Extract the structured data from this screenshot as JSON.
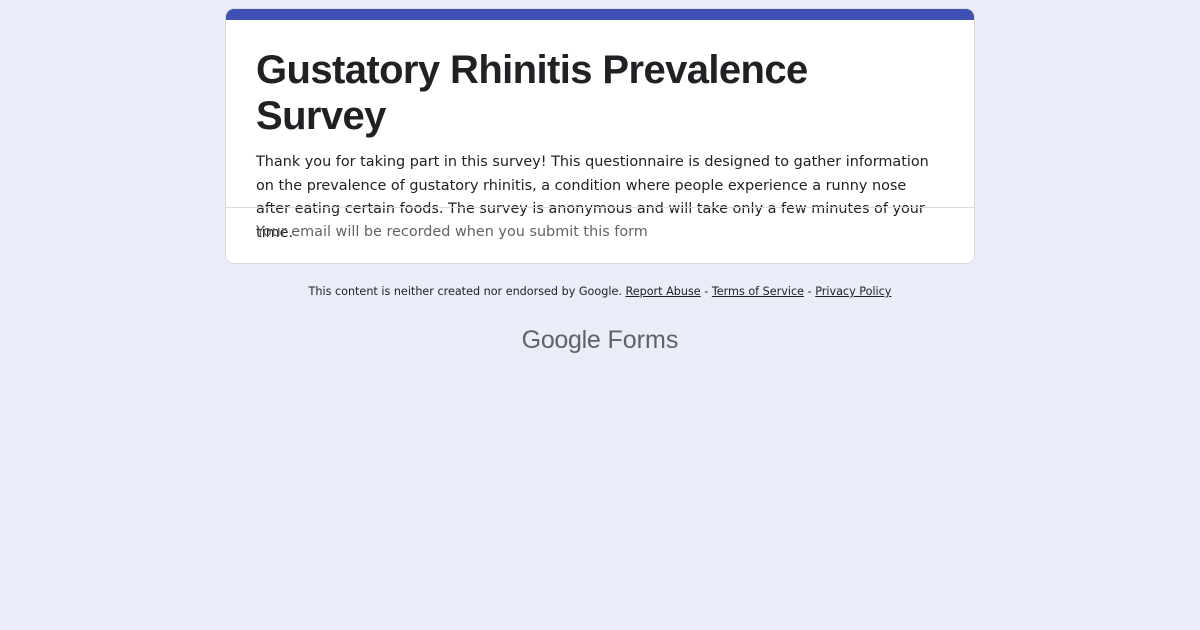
{
  "form": {
    "title": "Gustatory Rhinitis Prevalence Survey",
    "description": "Thank you for taking part in this survey! This questionnaire is designed to gather information on the prevalence of gustatory rhinitis, a condition where people experience a runny nose after eating certain foods. The survey is anonymous and will take only a few minutes of your time.",
    "email_note": "Your email will be recorded when you submit this form"
  },
  "footer": {
    "disclaimer": "This content is neither created nor endorsed by Google.",
    "report_abuse": "Report Abuse",
    "separator": "-",
    "terms": "Terms of Service",
    "privacy": "Privacy Policy"
  },
  "logo": {
    "google": "Google",
    "forms": "Forms"
  },
  "colors": {
    "page_background": "#eaedf7",
    "accent": "#3f51b5",
    "card_background": "#ffffff",
    "muted_text": "#5f6368"
  }
}
